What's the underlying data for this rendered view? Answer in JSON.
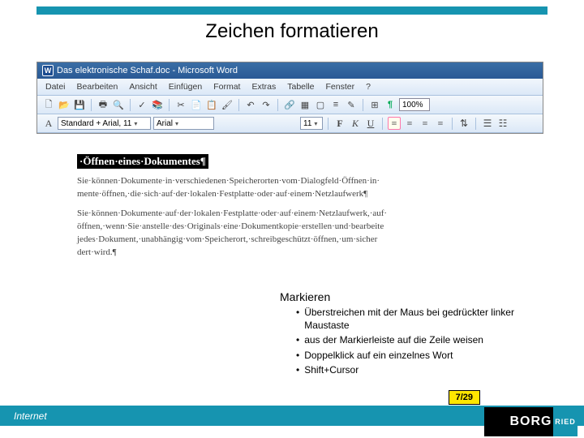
{
  "title": "Zeichen formatieren",
  "word_window": {
    "title": "Das elektronische Schaf.doc - Microsoft Word",
    "menu": [
      "Datei",
      "Bearbeiten",
      "Ansicht",
      "Einfügen",
      "Format",
      "Extras",
      "Tabelle",
      "Fenster",
      "?"
    ],
    "zoom": "100%",
    "style": "Standard + Arial, 11",
    "font": "Arial",
    "size": "11",
    "pilcrow": "¶",
    "fmt_bold": "F",
    "fmt_italic": "K",
    "fmt_underline": "U"
  },
  "document": {
    "heading": "·Öffnen·eines·Dokumentes¶",
    "p1_l1": "Sie·können·Dokumente·in·verschiedenen·Speicherorten·vom·Dialogfeld·Öffnen·in·",
    "p1_l2": "mente·öffnen,·die·sich·auf·der·lokalen·Festplatte·oder·auf·einem·Netzlaufwerk¶",
    "p2_l1": "Sie·können·Dokumente·auf·der·lokalen·Festplatte·oder·auf·einem·Netzlaufwerk,·auf·",
    "p2_l2": "öffnen,·wenn·Sie·anstelle·des·Originals·eine·Dokumentkopie·erstellen·und·bearbeite",
    "p2_l3": "jedes·Dokument,·unabhängig·vom·Speicherort,·schreibgeschützt·öffnen,·um·sicher",
    "p2_l4": "dert·wird.¶"
  },
  "section": "Markieren",
  "bullets": [
    "Überstreichen mit der Maus bei gedrückter linker Maustaste",
    "aus der Markierleiste auf die Zeile weisen",
    "Doppelklick auf ein einzelnes Wort",
    "Shift+Cursor"
  ],
  "footer": {
    "label": "Internet",
    "pager": "7/29",
    "logo": "BORG",
    "logo_accent": "RIED"
  }
}
